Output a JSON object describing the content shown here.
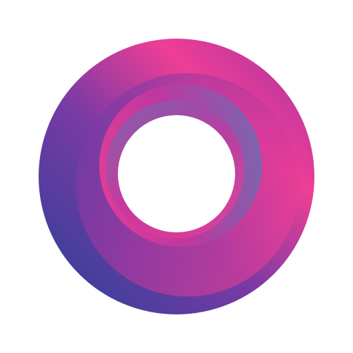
{
  "logo": {
    "icon": "gradient-ring-logo-icon",
    "colors": {
      "pink": "#ee3e95",
      "magenta": "#c2379f",
      "purple": "#7b3aa5",
      "indigo": "#3f3f9b",
      "lavender": "#6c6cb2",
      "background": "#ffffff"
    }
  }
}
